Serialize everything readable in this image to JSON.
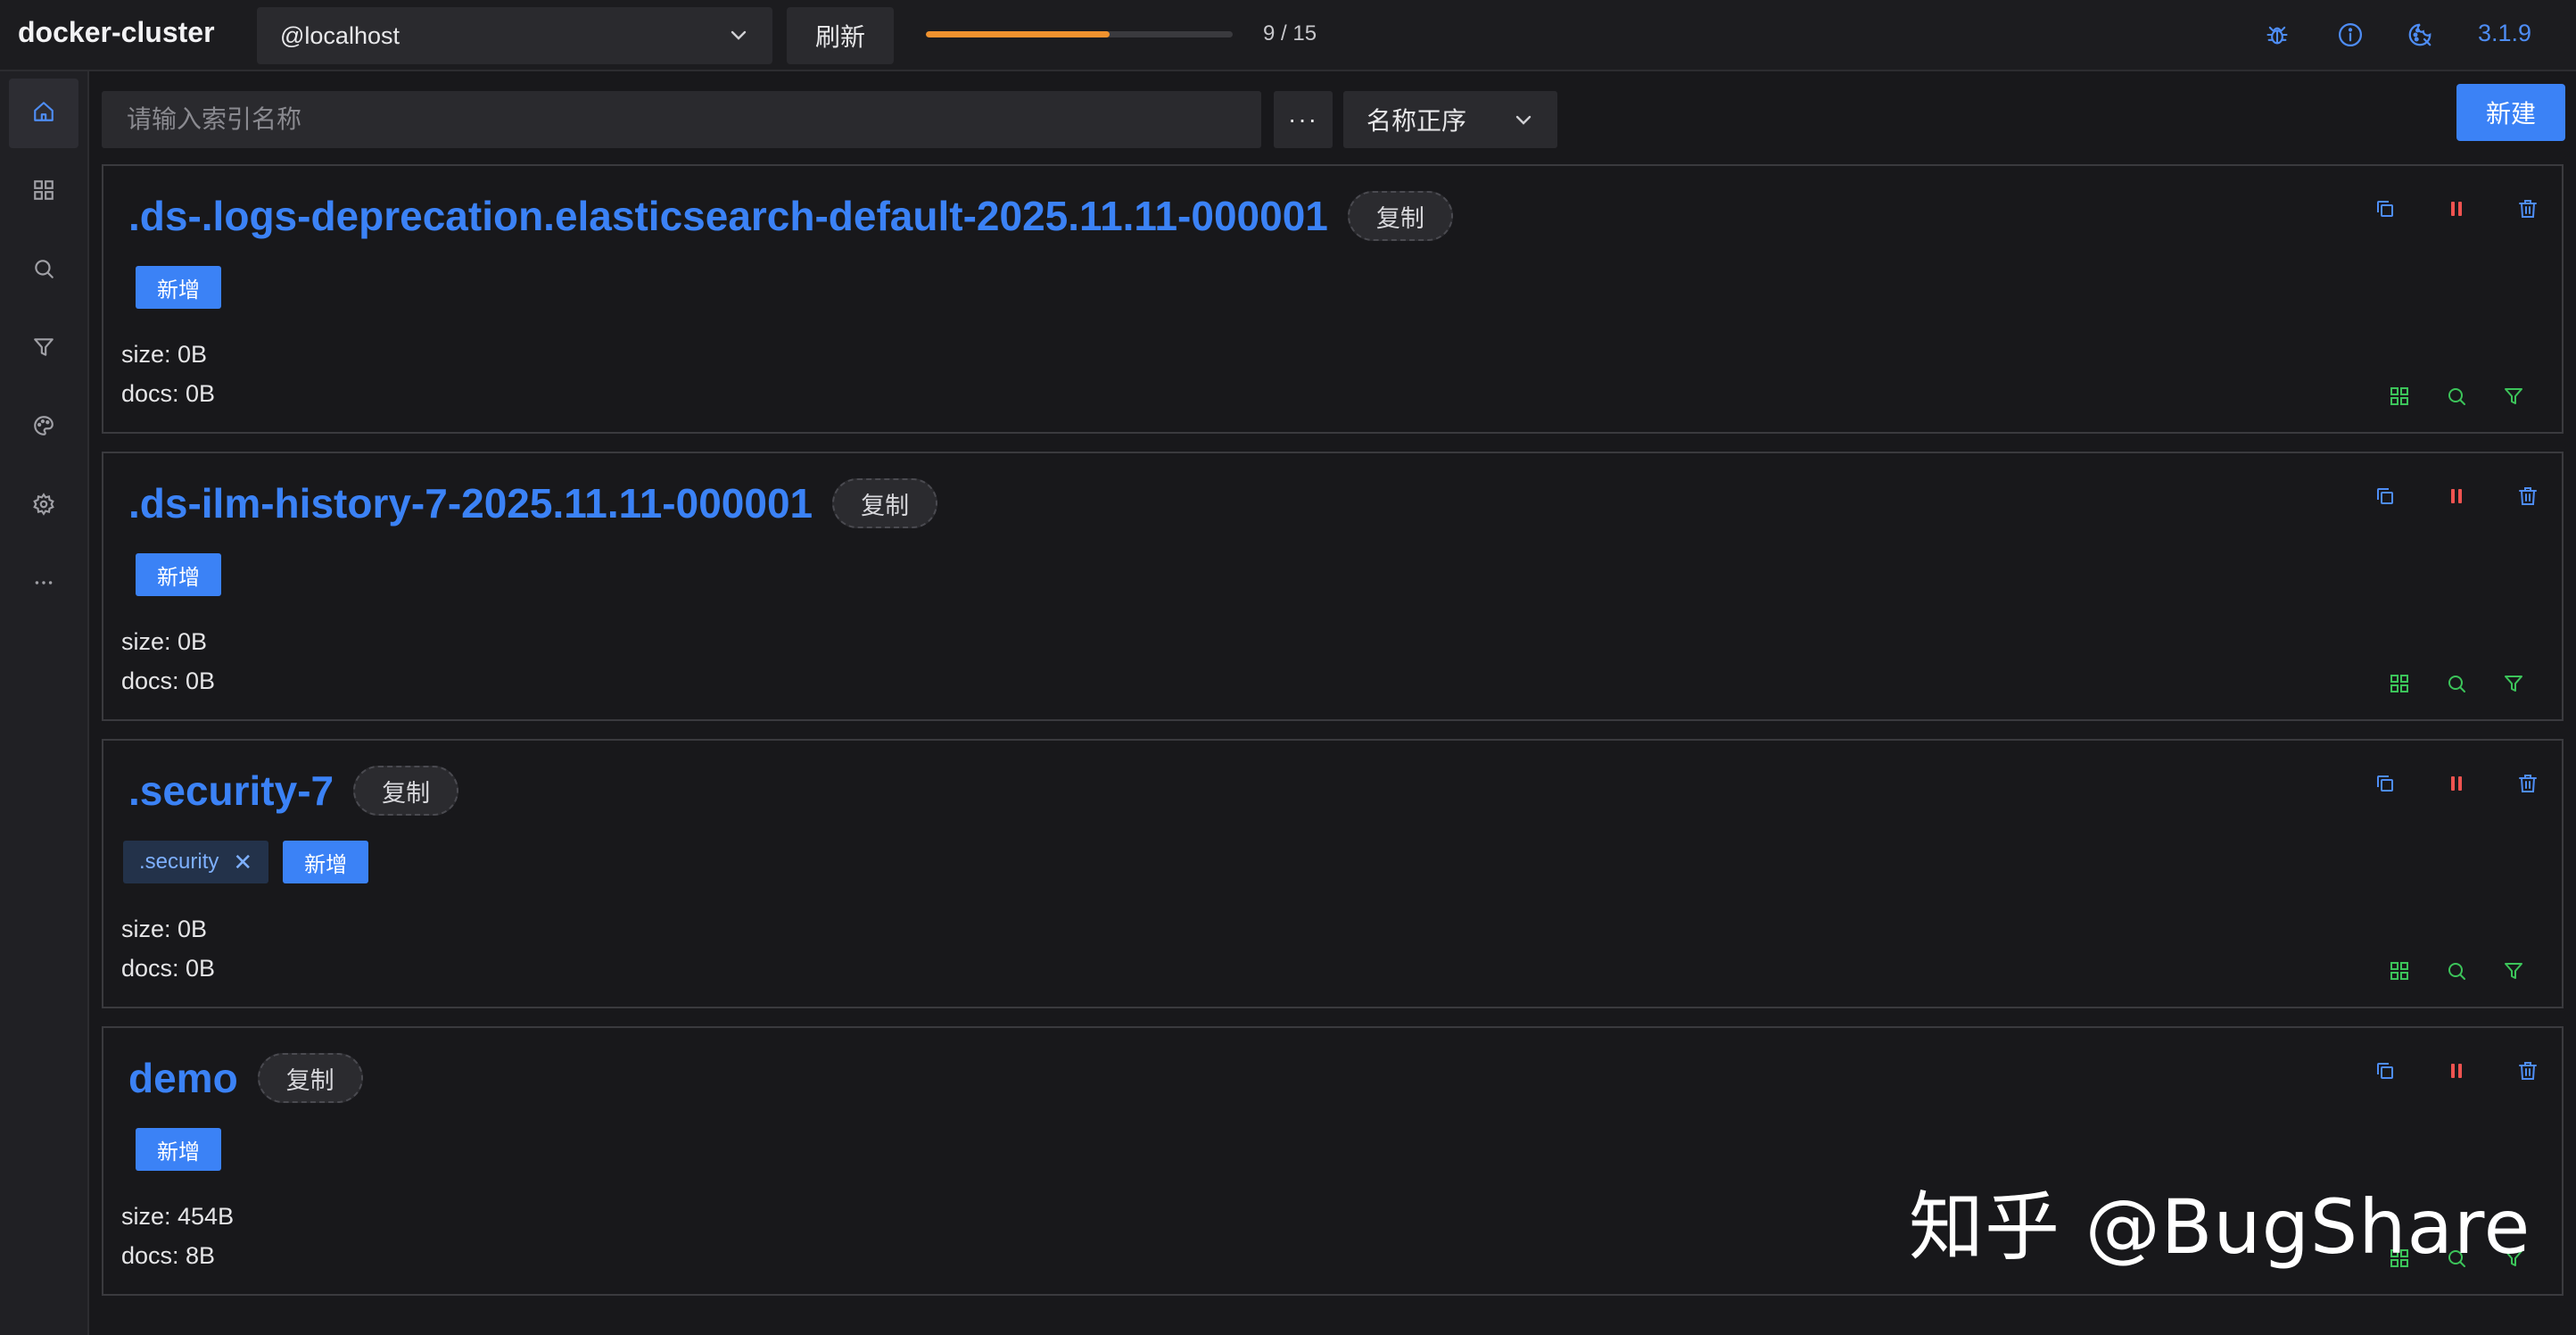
{
  "header": {
    "app_title": "docker-cluster",
    "host_value": "@localhost",
    "refresh_label": "刷新",
    "progress": {
      "current": 9,
      "total": 15,
      "fraction": 0.6,
      "text": "9 / 15"
    },
    "icons": [
      "bug-icon",
      "info-icon",
      "theme-icon"
    ],
    "version": "3.1.9"
  },
  "sidebar": {
    "items": [
      {
        "icon": "home-icon",
        "active": true
      },
      {
        "icon": "grid-icon",
        "active": false
      },
      {
        "icon": "search-icon",
        "active": false
      },
      {
        "icon": "filter-icon",
        "active": false
      },
      {
        "icon": "palette-icon",
        "active": false
      },
      {
        "icon": "gear-icon",
        "active": false
      },
      {
        "icon": "more-icon",
        "active": false
      }
    ]
  },
  "toolbar": {
    "search_placeholder": "请输入索引名称",
    "more_label": "···",
    "sort_value": "名称正序",
    "new_label": "新建"
  },
  "indices": [
    {
      "name": ".ds-.logs-deprecation.elasticsearch-default-2025.11.11-000001",
      "copy_label": "复制",
      "aliases": [],
      "add_label": "新增",
      "size": "size: 0B",
      "docs": "docs: 0B"
    },
    {
      "name": ".ds-ilm-history-7-2025.11.11-000001",
      "copy_label": "复制",
      "aliases": [],
      "add_label": "新增",
      "size": "size: 0B",
      "docs": "docs: 0B"
    },
    {
      "name": ".security-7",
      "copy_label": "复制",
      "aliases": [
        ".security"
      ],
      "add_label": "新增",
      "size": "size: 0B",
      "docs": "docs: 0B"
    },
    {
      "name": "demo",
      "copy_label": "复制",
      "aliases": [],
      "add_label": "新增",
      "size": "size: 454B",
      "docs": "docs: 8B"
    }
  ],
  "card_actions": {
    "top": [
      "copy-index-icon",
      "pause-icon",
      "delete-icon"
    ],
    "bottom": [
      "grid-icon",
      "search-icon",
      "filter-icon"
    ]
  },
  "colors": {
    "accent": "#3b82f6",
    "progress": "#f0922e",
    "danger": "#ef5350",
    "success": "#3cc45a",
    "background": "#18181b"
  },
  "watermark": "知乎 @BugShare"
}
